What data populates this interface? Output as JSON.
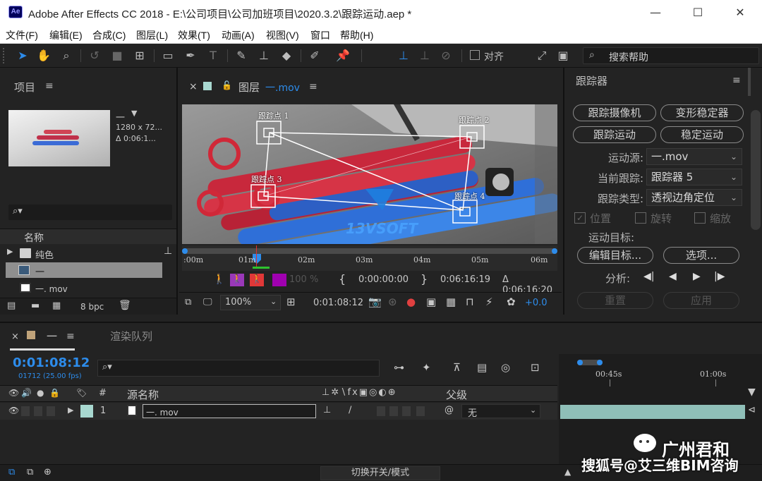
{
  "window": {
    "app_icon": "Ae",
    "title": "Adobe After Effects CC 2018 - E:\\公司项目\\公司加班项目\\2020.3.2\\跟踪运动.aep *",
    "minimize": "—",
    "maximize": "☐",
    "close": "✕"
  },
  "menu": [
    "文件(F)",
    "编辑(E)",
    "合成(C)",
    "图层(L)",
    "效果(T)",
    "动画(A)",
    "视图(V)",
    "窗口",
    "帮助(H)"
  ],
  "toolbar": {
    "align_label": "对齐",
    "help_placeholder": "搜索帮助",
    "icons": [
      "selection-tool-icon",
      "hand-tool-icon",
      "zoom-tool-icon",
      "rotate-tool-icon",
      "camera-tool-icon",
      "pan-behind-tool-icon",
      "rectangle-tool-icon",
      "pen-tool-icon",
      "type-tool-icon",
      "brush-tool-icon",
      "clone-stamp-tool-icon",
      "eraser-tool-icon",
      "roto-brush-tool-icon",
      "puppet-pin-tool-icon"
    ]
  },
  "project": {
    "title": "项目",
    "thumb_name": "一",
    "thumb_size": "1280 x 72...",
    "thumb_duration": "Δ 0:06:1...",
    "column_name": "名称",
    "items": [
      {
        "name": "纯色",
        "type": "folder"
      },
      {
        "name": "一",
        "type": "composition"
      },
      {
        "name": "一. mov",
        "type": "footage"
      }
    ],
    "bpc": "8 bpc"
  },
  "viewer": {
    "close": "×",
    "tab_prefix": "图层",
    "tab_name": "一.mov",
    "track_points": [
      "跟踪点 1",
      "跟踪点 2",
      "跟踪点 3",
      "跟踪点 4"
    ],
    "footage_logo": "13VSOFT",
    "ruler": [
      ":00m",
      "01m",
      "02m",
      "03m",
      "04m",
      "05m",
      "06m"
    ],
    "opacity": "100 %",
    "in_time": "0:00:00:00",
    "out_time": "0:06:16:19",
    "duration": "Δ 0:06:16:20",
    "zoom": "100%",
    "current_time": "0:01:08:12",
    "exposure": "+0.0"
  },
  "tracker": {
    "title": "跟踪器",
    "buttons": [
      "跟踪摄像机",
      "变形稳定器",
      "跟踪运动",
      "稳定运动"
    ],
    "motion_source_label": "运动源:",
    "motion_source": "一.mov",
    "current_track_label": "当前跟踪:",
    "current_track": "跟踪器 5",
    "track_type_label": "跟踪类型:",
    "track_type": "透视边角定位",
    "checkboxes": [
      {
        "label": "位置",
        "checked": true
      },
      {
        "label": "旋转",
        "checked": false
      },
      {
        "label": "缩放",
        "checked": false
      }
    ],
    "motion_target_label": "运动目标:",
    "edit_target": "编辑目标...",
    "options": "选项...",
    "analyze_label": "分析:",
    "reset": "重置",
    "apply": "应用"
  },
  "timeline": {
    "comp_tab": "一",
    "render_queue_tab": "渲染队列",
    "timecode": "0:01:08:12",
    "frame_info": "01712 (25.00 fps)",
    "header": {
      "num": "#",
      "source_name": "源名称",
      "parent": "父级"
    },
    "layer": {
      "num": "1",
      "name": "一. mov",
      "parent": "无"
    },
    "ruler": [
      "00:45s",
      "01:00s"
    ],
    "toggle_label": "切换开关/模式"
  },
  "watermark": {
    "line1": "广州君和",
    "line2": "搜狐号@艾三维BIM咨询"
  },
  "colors": {
    "accent": "#2d8ceb",
    "track_point": "#ffffff",
    "layer_color": "#a8d8d0"
  }
}
